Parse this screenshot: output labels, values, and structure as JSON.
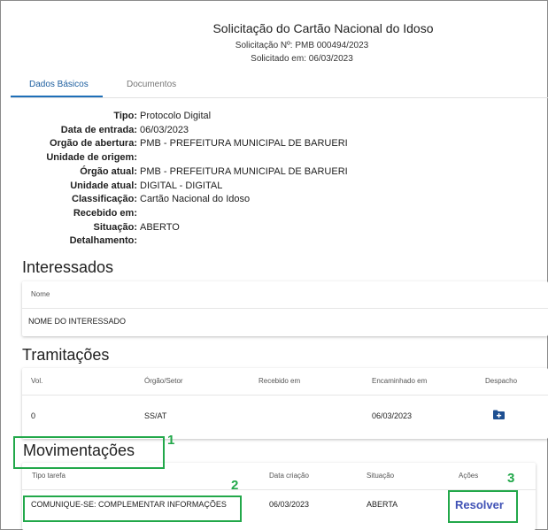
{
  "header": {
    "title": "Solicitação do Cartão Nacional do Idoso",
    "request_number": "Solicitação Nº: PMB 000494/2023",
    "requested_on": "Solicitado em: 06/03/2023"
  },
  "tabs": [
    {
      "label": "Dados Básicos",
      "active": true
    },
    {
      "label": "Documentos",
      "active": false
    }
  ],
  "fields": [
    {
      "label": "Tipo:",
      "value": "Protocolo Digital"
    },
    {
      "label": "Data de entrada:",
      "value": "06/03/2023"
    },
    {
      "label": "Orgão de abertura:",
      "value": "PMB - PREFEITURA MUNICIPAL DE BARUERI"
    },
    {
      "label": "Unidade de origem:",
      "value": ""
    },
    {
      "label": "Órgão atual:",
      "value": "PMB - PREFEITURA MUNICIPAL DE BARUERI"
    },
    {
      "label": "Unidade atual:",
      "value": "DIGITAL - DIGITAL"
    },
    {
      "label": "Classificação:",
      "value": "Cartão Nacional do Idoso"
    },
    {
      "label": "Recebido em:",
      "value": ""
    },
    {
      "label": "Situação:",
      "value": "ABERTO"
    },
    {
      "label": "Detalhamento:",
      "value": ""
    }
  ],
  "interessados": {
    "title": "Interessados",
    "header_nome": "Nome",
    "row_nome": "NOME DO INTERESSADO"
  },
  "tramitacoes": {
    "title": "Tramitações",
    "headers": [
      "Vol.",
      "Órgão/Setor",
      "Recebido em",
      "Encaminhado em",
      "Despacho"
    ],
    "row": {
      "vol": "0",
      "orgao": "SS/AT",
      "recebido": "",
      "encaminhado": "06/03/2023",
      "despacho_icon": "folder-add-icon"
    }
  },
  "movimentacoes": {
    "title": "Movimentações",
    "headers": [
      "Tipo tarefa",
      "Data criação",
      "Situação",
      "Ações"
    ],
    "row": {
      "tipo": "COMUNIQUE-SE: COMPLEMENTAR INFORMAÇÕES",
      "data": "06/03/2023",
      "situacao": "ABERTA",
      "acao": "Resolver"
    }
  },
  "annotations": {
    "n1": "1",
    "n2": "2",
    "n3": "3",
    "color": "#22a84a"
  },
  "colors": {
    "accent": "#1e6fb8",
    "link": "#3f51b5"
  }
}
